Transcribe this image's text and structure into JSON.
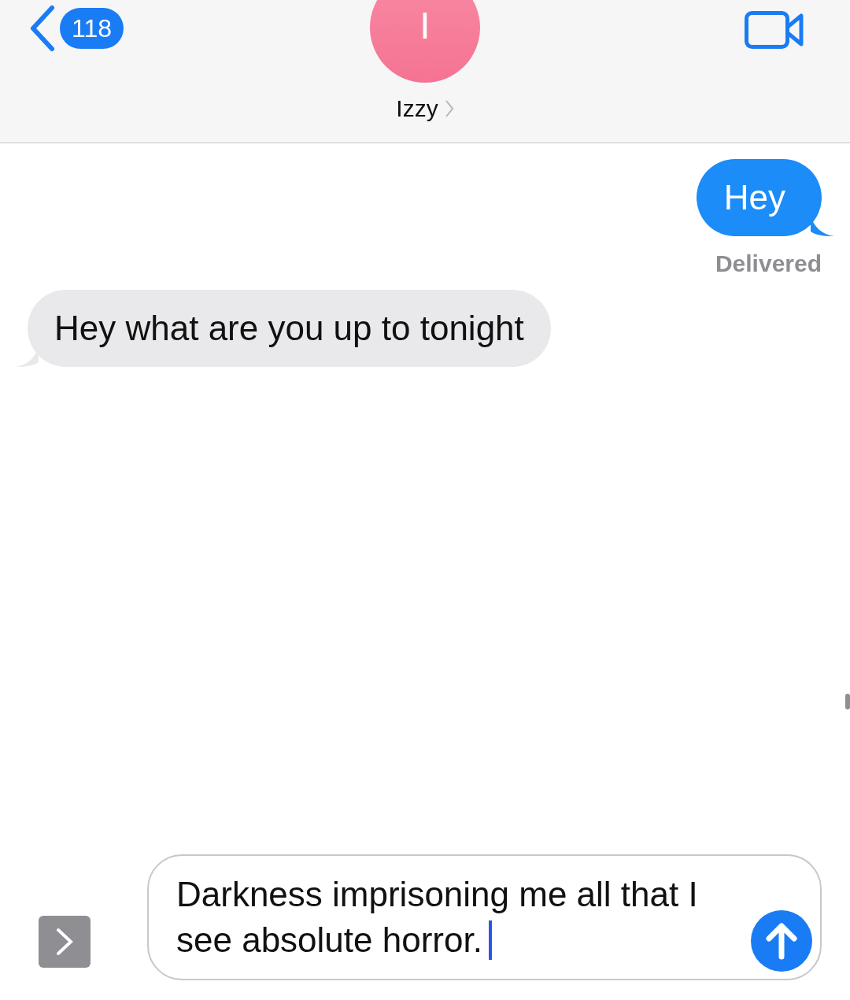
{
  "header": {
    "back_badge": "118",
    "avatar_initial": "I",
    "contact_name": "Izzy"
  },
  "messages": [
    {
      "kind": "sent",
      "text": "Hey",
      "status": "Delivered"
    },
    {
      "kind": "received",
      "text": "Hey what are you up to tonight"
    }
  ],
  "composer": {
    "value": "Darkness imprisoning me all that I see absolute horror.",
    "focused": true
  }
}
